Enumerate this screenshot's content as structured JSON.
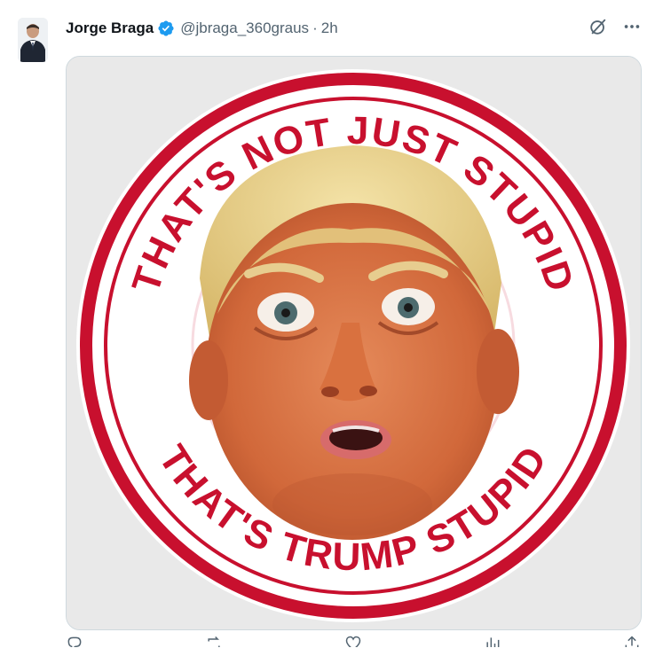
{
  "tweet": {
    "author_name": "Jorge Braga",
    "handle": "@jbraga_360graus",
    "separator": "·",
    "time": "2h",
    "verified": true,
    "icons": {
      "avatar": "profile-photo",
      "verified": "verified-badge-icon",
      "grok": "grok-icon",
      "more": "more-options-icon"
    }
  },
  "media": {
    "stamp_top_text": "THAT'S NOT JUST STUPID",
    "stamp_bottom_text": "THAT'S TRUMP STUPID",
    "colors": {
      "stamp_red": "#c8102e",
      "background": "#e9e9e9",
      "verified_blue": "#1d9bf0"
    }
  },
  "action_bar": {
    "icons": [
      "reply-icon",
      "retweet-icon",
      "like-icon",
      "views-icon",
      "share-icon"
    ]
  }
}
